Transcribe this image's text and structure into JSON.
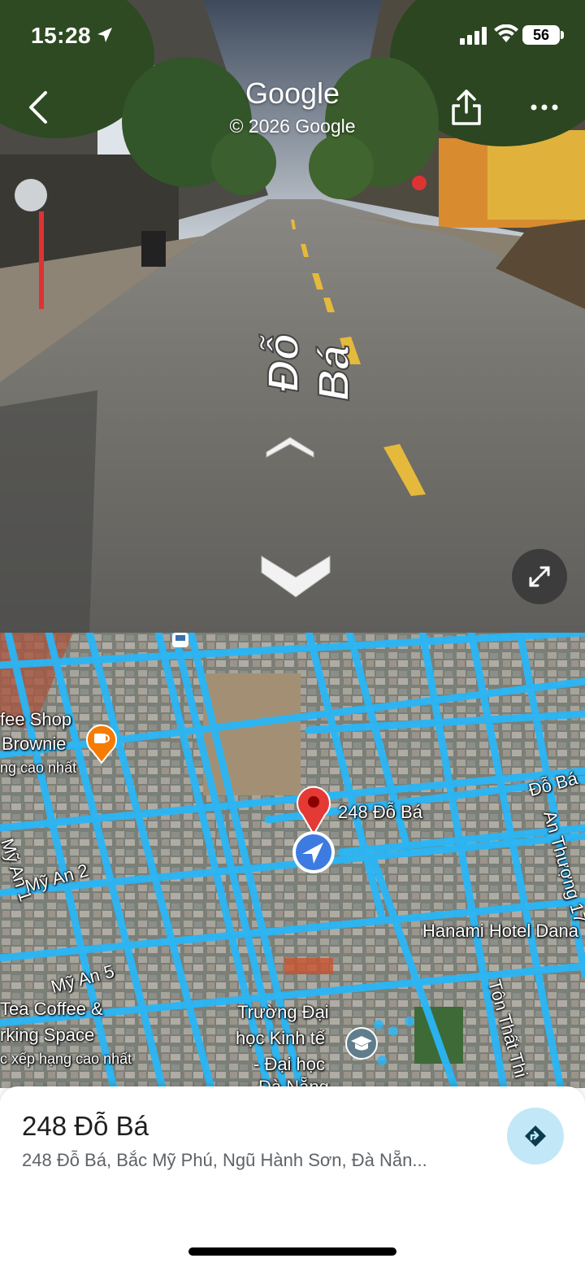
{
  "status_bar": {
    "time": "15:28",
    "battery": "56"
  },
  "street_view": {
    "brand": "Google",
    "copyright": "© 2026 Google",
    "road_label": "Đỗ Bá",
    "icons": {
      "back": "chevron-left-icon",
      "share": "share-icon",
      "more": "more-horizontal-icon",
      "forward": "chevron-up-icon",
      "backward": "chevron-down-icon",
      "expand": "expand-icon"
    }
  },
  "map": {
    "labels": {
      "coffee_shop_1": "fee Shop",
      "coffee_shop_2": "Brownie",
      "coffee_shop_3": "ng cao nhất",
      "my_an_1": "Mỹ An 1",
      "my_an_2": "Mỹ An 2",
      "my_an_5": "Mỹ An 5",
      "tea_1": "Tea Coffee &",
      "tea_2": "rking Space",
      "tea_3": "c xếp hạng cao nhất",
      "pin_address": "248 Đỗ Bá",
      "do_ba": "Đỗ Bá",
      "an_thuong": "An Thượng 17",
      "hanami": "Hanami Hotel Dana",
      "ton_that": "Tôn Thất Thi",
      "truong_1": "Trường Đại",
      "truong_2": "học Kinh tế",
      "truong_3": "- Đại học",
      "truong_4": "Đà Nẵng"
    }
  },
  "place": {
    "title": "248 Đỗ Bá",
    "address": "248 Đỗ Bá, Bắc Mỹ Phú, Ngũ Hành Sơn, Đà Nẵn..."
  },
  "colors": {
    "street_overlay_blue": "#29b6f6",
    "pin_red": "#e53935",
    "location_blue": "#3d7be0",
    "directions_bg": "#c2e7f7",
    "directions_icon": "#0b3b4f"
  }
}
